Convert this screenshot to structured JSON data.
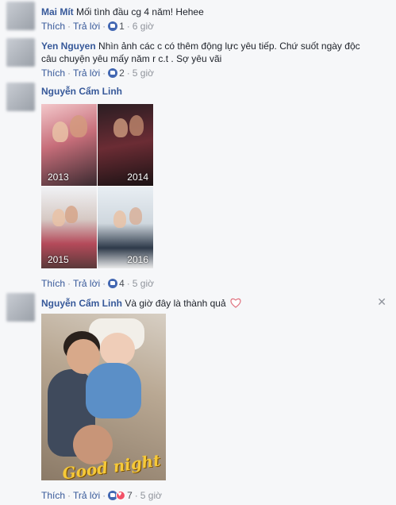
{
  "comments": [
    {
      "author": "Mai Mít",
      "text": "Mối tình đầu cg 4 năm! Hehee",
      "actions": {
        "like": "Thích",
        "reply": "Trả lời",
        "reactions": "1",
        "time": "6 giờ"
      }
    },
    {
      "author": "Yen Nguyen",
      "text_line1": "Nhìn ảnh các c có thêm động lực yêu tiếp. Chứ suốt ngày độc",
      "text_line2": "câu chuyện yêu mấy năm r c.t . Sợ yêu vãi",
      "actions": {
        "like": "Thích",
        "reply": "Trả lời",
        "reactions": "2",
        "time": "5 giờ"
      }
    },
    {
      "author": "Nguyễn Cẩm Linh",
      "photo_years": [
        "2013",
        "2014",
        "2015",
        "2016"
      ],
      "actions": {
        "like": "Thích",
        "reply": "Trả lời",
        "reactions": "4",
        "time": "5 giờ"
      }
    },
    {
      "author": "Nguyễn Cẩm Linh",
      "text": "Và giờ đây là thành quả",
      "photo_caption": "Good night",
      "actions": {
        "like": "Thích",
        "reply": "Trả lời",
        "reactions": "7",
        "time": "5 giờ"
      }
    }
  ],
  "icons": {
    "like": "like-icon",
    "love": "love-icon",
    "close": "close-icon",
    "heart": "heart-emoji-icon"
  },
  "colors": {
    "link": "#365899",
    "like": "#4267b2",
    "love": "#f25268",
    "meta": "#90949c"
  }
}
